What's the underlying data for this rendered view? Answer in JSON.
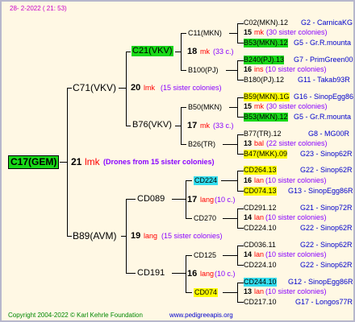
{
  "date": "28-  2-2022 ( 21: 53)",
  "root": {
    "name": "C17(GEM)",
    "num": "21",
    "ab": "lmk",
    "note": "(Drones from 15 sister colonies)"
  },
  "gen1": [
    {
      "name": "C71(VKV)",
      "num": "20",
      "ab": "lmk",
      "note": "(15 sister colonies)"
    },
    {
      "name": "B89(AVM)",
      "num": "19",
      "ab": "lang",
      "note": "(15 sister colonies)"
    }
  ],
  "gen2": [
    {
      "name": "C21(VKV)",
      "num": "18",
      "ab": "mk",
      "note": "(33 c.)"
    },
    {
      "name": "B76(VKV)",
      "num": "17",
      "ab": "mk",
      "note": "(33 c.)"
    },
    {
      "name": "CD089",
      "num": "17",
      "ab": "lang",
      "note": "(10 c.)"
    },
    {
      "name": "CD191",
      "num": "16",
      "ab": "lang",
      "note": "(10 c.)"
    }
  ],
  "gen3": [
    {
      "name": "C11(MKN)",
      "num": "15",
      "ab": "mk",
      "note": "(30 sister colonies)"
    },
    {
      "name": "B100(PJ)",
      "num": "16",
      "ab": "ins",
      "note": "(10 sister colonies)"
    },
    {
      "name": "B50(MKN)",
      "num": "15",
      "ab": "mk",
      "note": "(30 sister colonies)"
    },
    {
      "name": "B26(TR)",
      "num": "13",
      "ab": "bal",
      "note": "(22 sister colonies)"
    },
    {
      "name": "CD224",
      "num": "16",
      "ab": "lan",
      "note": "(10 sister colonies)"
    },
    {
      "name": "CD270",
      "num": "14",
      "ab": "lan",
      "note": "(10 sister colonies)"
    },
    {
      "name": "CD125",
      "num": "14",
      "ab": "lan",
      "note": "(10 sister colonies)"
    },
    {
      "name": "CD074",
      "num": "13",
      "ab": "lan",
      "note": "(10 sister colonies)"
    }
  ],
  "gen4": [
    {
      "name": "C02(MKN).12",
      "ref": "G2 - CarnicaKG"
    },
    {
      "name": "B53(MKN).12",
      "ref": "G5 - Gr.R.mounta"
    },
    {
      "name": "B240(PJ).13",
      "ref": "G7 - PrimGreen00"
    },
    {
      "name": "B180(PJ).12",
      "ref": "G11 - Takab93R"
    },
    {
      "name": "B59(MKN).1G",
      "ref": "G16 - SinopEgg86R"
    },
    {
      "name": "B53(MKN).12",
      "ref": "G5 - Gr.R.mounta"
    },
    {
      "name": "B77(TR).12",
      "ref": "G8 - MG00R"
    },
    {
      "name": "B47(MKK).09",
      "ref": "G23 - Sinop62R"
    },
    {
      "name": "CD264.13",
      "ref": "G22 - Sinop62R"
    },
    {
      "name": "CD074.13",
      "ref": "G13 - SinopEgg86R"
    },
    {
      "name": "CD291.12",
      "ref": "G21 - Sinop72R"
    },
    {
      "name": "CD224.10",
      "ref": "G22 - Sinop62R"
    },
    {
      "name": "CD036.11",
      "ref": "G22 - Sinop62R"
    },
    {
      "name": "CD224.10",
      "ref": "G22 - Sinop62R"
    },
    {
      "name": "CD244.10",
      "ref": "G12 - SinopEgg86R"
    },
    {
      "name": "CD217.10",
      "ref": "G17 - Longos77R"
    }
  ],
  "footer": {
    "copyright": "Copyright 2004-2022 © Karl Kehrle Foundation",
    "website": "www.pedigreeapis.org"
  }
}
